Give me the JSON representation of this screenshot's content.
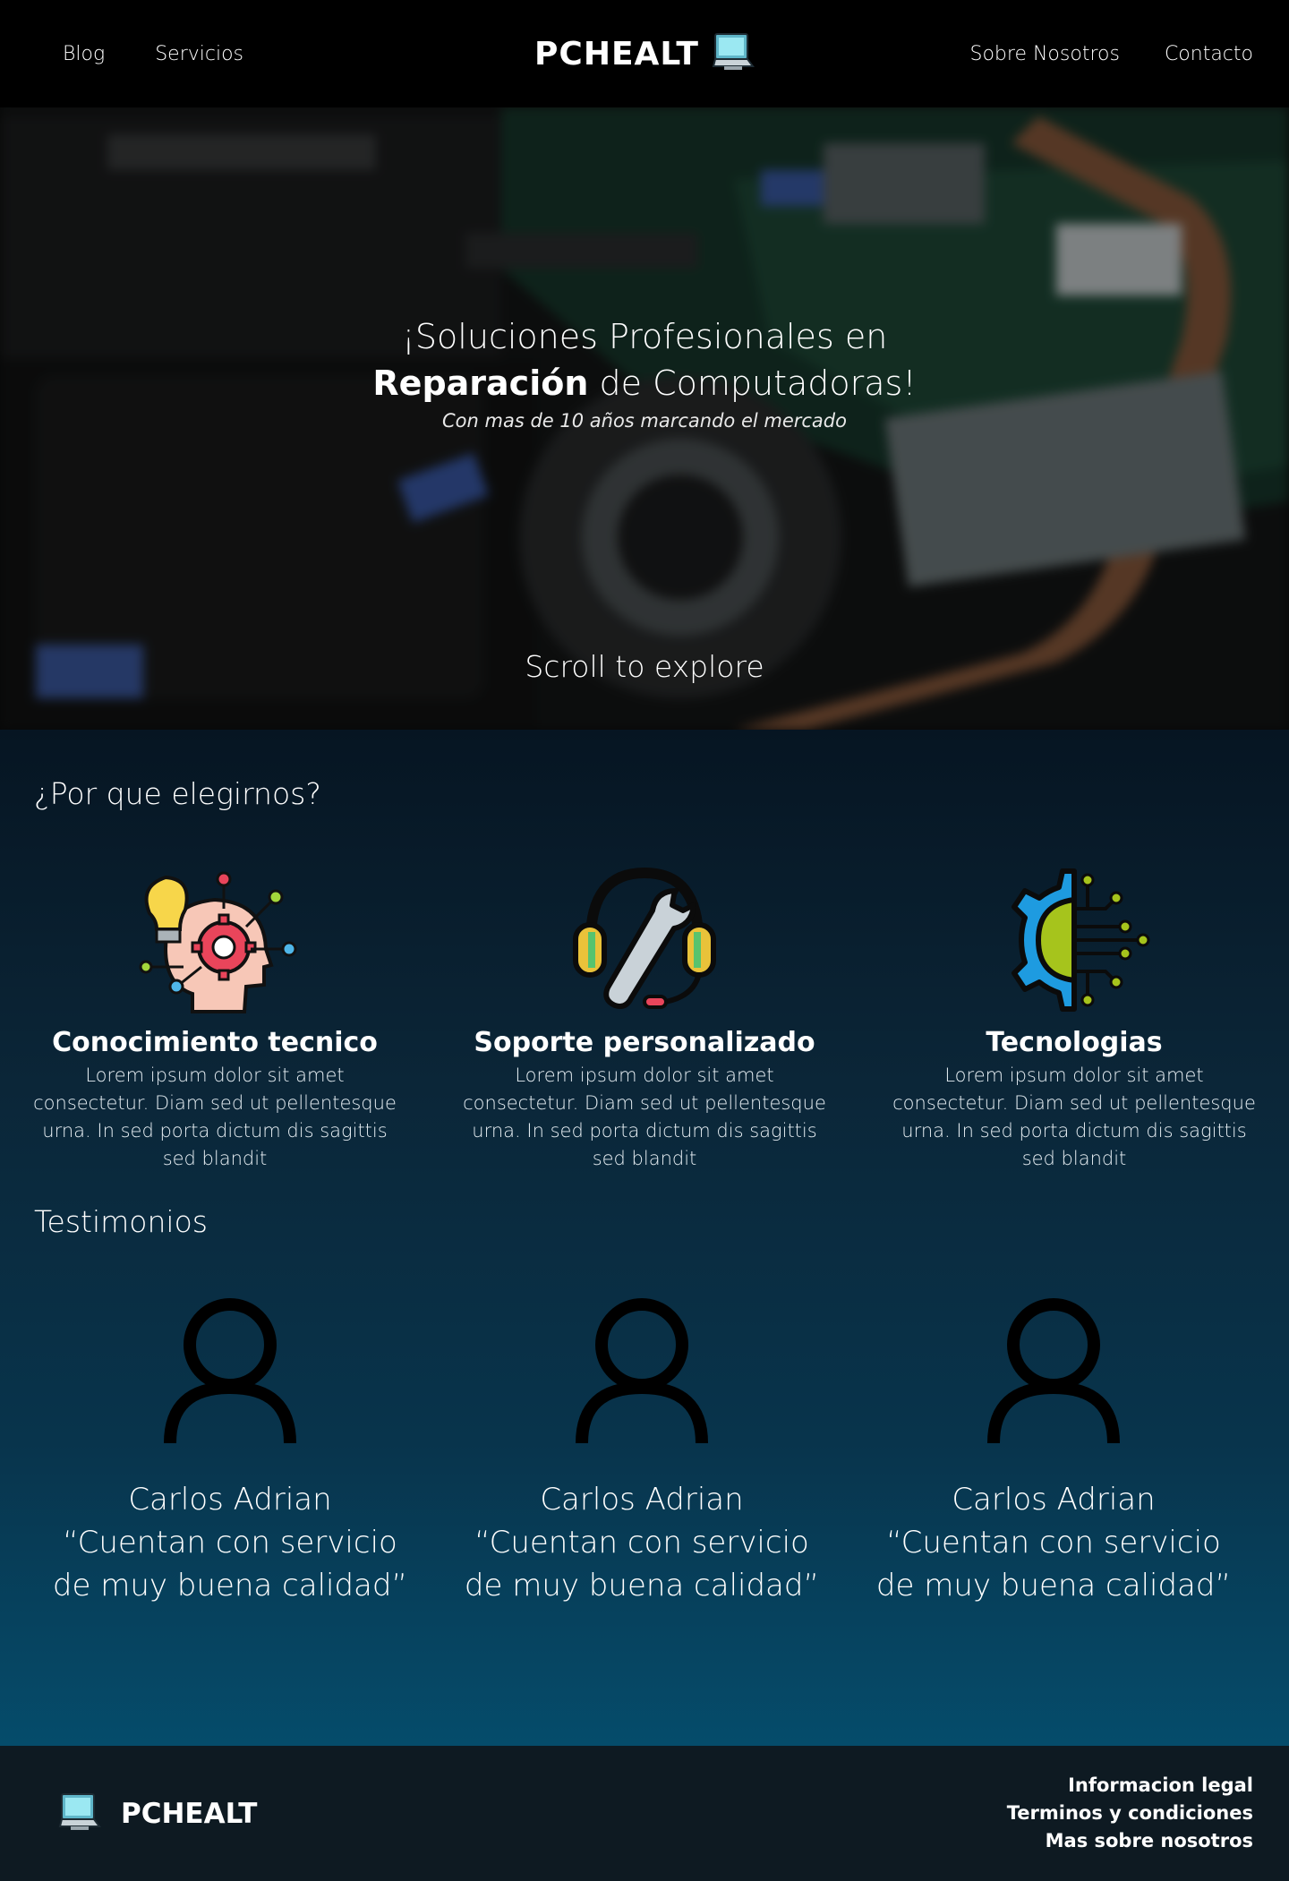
{
  "header": {
    "nav_left": [
      "Blog",
      "Servicios"
    ],
    "brand": "PCHEALT",
    "nav_right": [
      "Sobre Nosotros",
      "Contacto"
    ]
  },
  "hero": {
    "line1": "¡Soluciones Profesionales en",
    "line2_bold": "Reparación",
    "line2_rest": " de Computadoras!",
    "subtitle": "Con mas de 10 años marcando el mercado",
    "scroll_hint": "Scroll to explore"
  },
  "why": {
    "title": "¿Por que elegirnos?",
    "features": [
      {
        "icon": "brain-gear-icon",
        "title": "Conocimiento tecnico",
        "desc": "Lorem ipsum dolor sit amet consectetur. Diam sed ut pellentesque urna. In sed porta dictum dis sagittis sed blandit"
      },
      {
        "icon": "headset-wrench-icon",
        "title": "Soporte personalizado",
        "desc": "Lorem ipsum dolor sit amet consectetur. Diam sed ut pellentesque urna. In sed porta dictum dis sagittis sed blandit"
      },
      {
        "icon": "tech-gear-circuit-icon",
        "title": "Tecnologias",
        "desc": "Lorem ipsum dolor sit amet consectetur. Diam sed ut pellentesque urna. In sed porta dictum dis sagittis sed blandit"
      }
    ]
  },
  "testimonials": {
    "title": "Testimonios",
    "items": [
      {
        "name": "Carlos Adrian",
        "quote": "“Cuentan con servicio de muy buena calidad”"
      },
      {
        "name": "Carlos Adrian",
        "quote": "“Cuentan con servicio de muy buena calidad”"
      },
      {
        "name": "Carlos Adrian",
        "quote": "“Cuentan con servicio de muy buena calidad”"
      }
    ]
  },
  "footer": {
    "brand": "PCHEALT",
    "links": [
      "Informacion legal",
      "Terminos y condiciones",
      "Mas sobre nosotros"
    ]
  }
}
